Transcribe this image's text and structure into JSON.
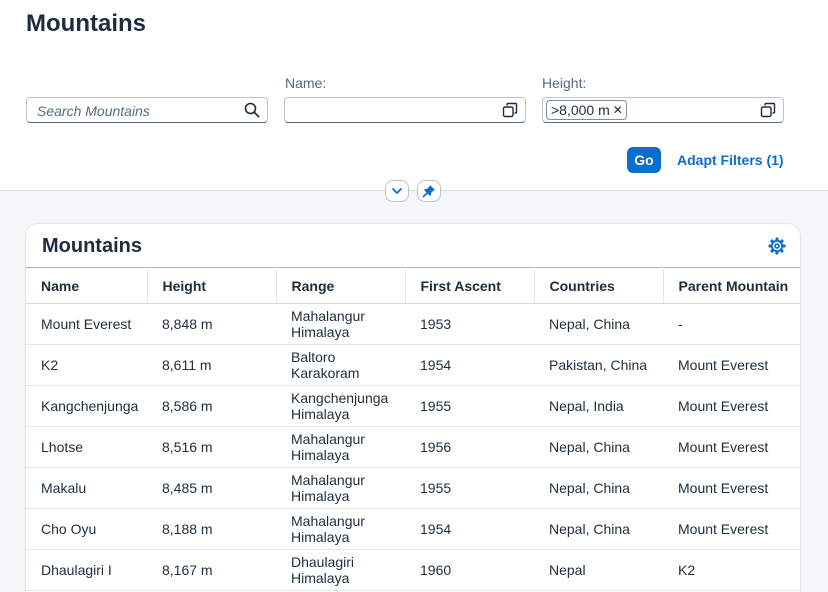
{
  "page": {
    "title": "Mountains"
  },
  "filters": {
    "search": {
      "placeholder": "Search Mountains"
    },
    "name": {
      "label": "Name:",
      "value": ""
    },
    "height": {
      "label": "Height:",
      "token": ">8,000 m"
    },
    "go_label": "Go",
    "adapt_label": "Adapt Filters (1)"
  },
  "table": {
    "title": "Mountains",
    "columns": [
      "Name",
      "Height",
      "Range",
      "First Ascent",
      "Countries",
      "Parent Mountain"
    ],
    "rows": [
      [
        "Mount Everest",
        "8,848 m",
        [
          "Mahalangur",
          "Himalaya"
        ],
        "1953",
        "Nepal, China",
        "-"
      ],
      [
        "K2",
        "8,611 m",
        [
          "Baltoro",
          "Karakoram"
        ],
        "1954",
        "Pakistan, China",
        "Mount Everest"
      ],
      [
        "Kangchenjunga",
        "8,586 m",
        [
          "Kangchenjunga",
          "Himalaya"
        ],
        "1955",
        "Nepal, India",
        "Mount Everest"
      ],
      [
        "Lhotse",
        "8,516 m",
        [
          "Mahalangur",
          "Himalaya"
        ],
        "1956",
        "Nepal, China",
        "Mount Everest"
      ],
      [
        "Makalu",
        "8,485 m",
        [
          "Mahalangur",
          "Himalaya"
        ],
        "1955",
        "Nepal, China",
        "Mount Everest"
      ],
      [
        "Cho Oyu",
        "8,188 m",
        [
          "Mahalangur",
          "Himalaya"
        ],
        "1954",
        "Nepal, China",
        "Mount Everest"
      ],
      [
        "Dhaulagiri I",
        "8,167 m",
        [
          "Dhaulagiri",
          "Himalaya"
        ],
        "1960",
        "Nepal",
        "K2"
      ]
    ]
  },
  "icons": {
    "search": "search-icon",
    "value_help": "value-help-icon",
    "collapse": "chevron-down-icon",
    "pin": "pin-icon",
    "settings": "gear-icon"
  },
  "colors": {
    "accent": "#0a6ed1",
    "text": "#1d2d3e",
    "background": "#f5f6f7"
  }
}
